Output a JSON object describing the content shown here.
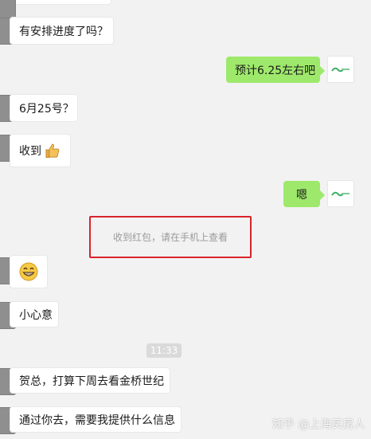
{
  "colors": {
    "background": "#f2f2f2",
    "incoming_bubble": "#ffffff",
    "outgoing_bubble": "#9ee96b",
    "highlight_box": "#d9232a",
    "timestamp_bg": "#dadada"
  },
  "messages": [
    {
      "side": "left",
      "text": "有安排进度了吗？"
    },
    {
      "side": "right",
      "text": "预计6.25左右吧"
    },
    {
      "side": "left",
      "text": "6月25号？"
    },
    {
      "side": "left",
      "text": "收到",
      "emoji": "thumbs-up-emoji"
    },
    {
      "side": "right",
      "text": "嗯"
    },
    {
      "side": "left",
      "text": "",
      "emoji": "grinning-face-emoji"
    },
    {
      "side": "left",
      "text": "小心意"
    },
    {
      "side": "left",
      "text": "贺总，打算下周去看金桥世纪"
    },
    {
      "side": "left",
      "text": "通过你去，需要我提供什么信息"
    }
  ],
  "system_notice": "收到红包，请在手机上查看",
  "timestamp": "11:33",
  "watermark": "知乎 @上海买房人"
}
